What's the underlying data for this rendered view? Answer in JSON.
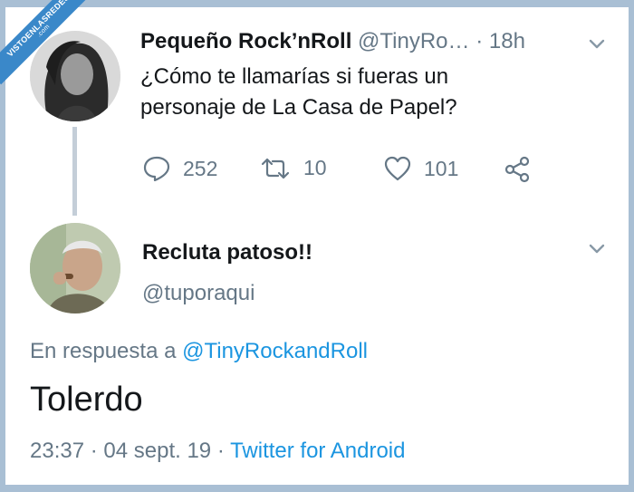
{
  "watermark": {
    "text": "VISTOENLASREDES",
    "sub": ".com"
  },
  "original_tweet": {
    "author_name": "Pequeño Rock’nRoll",
    "author_handle": "@TinyRo…",
    "time_sep": "·",
    "time": "18h",
    "text_line1": "¿Cómo te llamarías si fueras un",
    "text_line2": "personaje de La Casa de Papel?",
    "reply_count": "252",
    "retweet_count": "10",
    "like_count": "101"
  },
  "reply_tweet": {
    "author_name": "Recluta patoso!!",
    "author_handle": "@tuporaqui",
    "in_reply_prefix": "En respuesta a",
    "in_reply_to": "@TinyRockandRoll",
    "text": "Tolerdo",
    "timestamp": "23:37 · 04 sept. 19",
    "sep": "·",
    "source": "Twitter for Android"
  },
  "colors": {
    "link": "#1b95e0",
    "muted": "#657786",
    "frame": "#a9bfd4"
  }
}
